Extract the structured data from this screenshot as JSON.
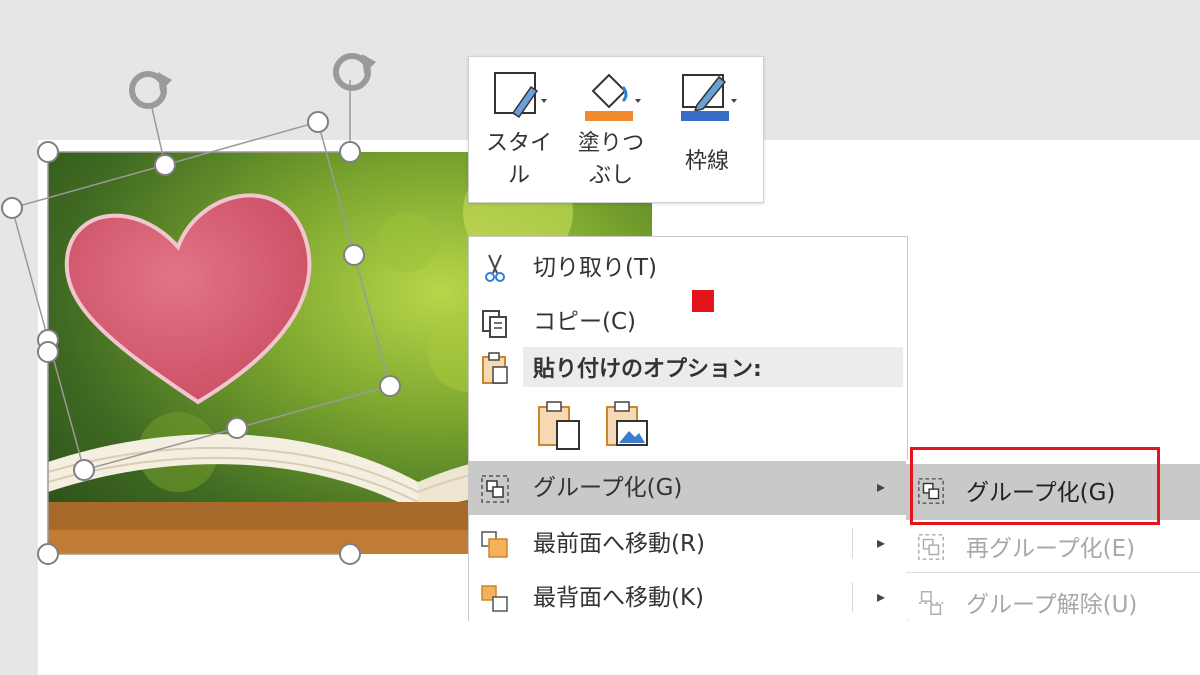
{
  "mini_toolbar": {
    "style_label_line1": "スタイ",
    "style_label_line2": "ル",
    "fill_label_line1": "塗りつ",
    "fill_label_line2": "ぶし",
    "border_label": "枠線",
    "fill_color": "#f08a2c",
    "border_color": "#3a6cc6"
  },
  "context_menu": {
    "cut_label": "切り取り(T)",
    "copy_label": "コピー(C)",
    "paste_options_header": "貼り付けのオプション:",
    "group_label": "グループ化(G)",
    "bring_front_label": "最前面へ移動(R)",
    "send_back_label": "最背面へ移動(K)",
    "arrow_glyph": "▸"
  },
  "submenu": {
    "group_label": "グループ化(G)",
    "regroup_label": "再グループ化(E)",
    "ungroup_label": "グループ解除(U)"
  },
  "colors": {
    "highlight": "#c9c9c9",
    "annotation_red": "#e3141c"
  }
}
